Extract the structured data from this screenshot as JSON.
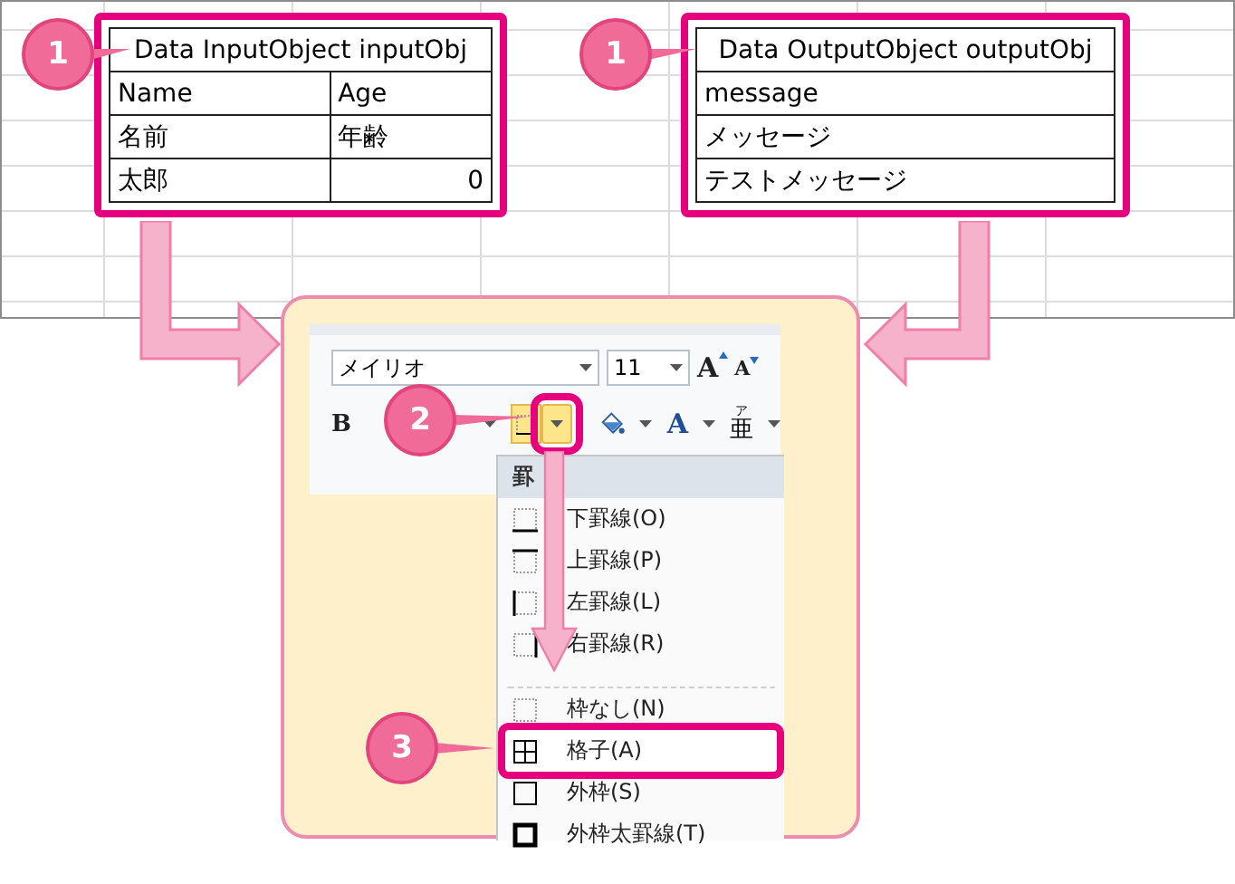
{
  "tables": [
    {
      "title": "Data InputObject inputObj",
      "rows": [
        [
          {
            "text": "Name",
            "kind": "text"
          },
          {
            "text": "Age",
            "kind": "text"
          }
        ],
        [
          {
            "text": "名前",
            "kind": "text"
          },
          {
            "text": "年齢",
            "kind": "text"
          }
        ],
        [
          {
            "text": "太郎",
            "kind": "text"
          },
          {
            "text": "0",
            "kind": "number"
          }
        ]
      ]
    },
    {
      "title": "Data OutputObject outputObj",
      "rows": [
        [
          {
            "text": "message",
            "kind": "text"
          }
        ],
        [
          {
            "text": "メッセージ",
            "kind": "text"
          }
        ],
        [
          {
            "text": "テストメッセージ",
            "kind": "text"
          }
        ]
      ]
    }
  ],
  "callouts": [
    {
      "number": "1"
    },
    {
      "number": "1"
    },
    {
      "number": "2"
    },
    {
      "number": "3"
    }
  ],
  "ribbon": {
    "font": "メイリオ",
    "size": "11",
    "grow": "A",
    "shrink": "A",
    "bold": "B",
    "font_color": "A",
    "phonetic": "亜",
    "phonetic_ruby": "ア",
    "border_dropdown_selected": true
  },
  "menu": {
    "header": "罫",
    "items": [
      {
        "label": "下罫線(O)",
        "kind": "bottom",
        "selected": false,
        "separator_before": false
      },
      {
        "label": "上罫線(P)",
        "kind": "top",
        "selected": false,
        "separator_before": false
      },
      {
        "label": "左罫線(L)",
        "kind": "left",
        "selected": false,
        "separator_before": false
      },
      {
        "label": "右罫線(R)",
        "kind": "right",
        "selected": false,
        "separator_before": false
      },
      {
        "label": "枠なし(N)",
        "kind": "none",
        "selected": false,
        "separator_before": true
      },
      {
        "label": "格子(A)",
        "kind": "all",
        "selected": true,
        "separator_before": false
      },
      {
        "label": "外枠(S)",
        "kind": "outside",
        "selected": false,
        "separator_before": false
      },
      {
        "label": "外枠太罫線(T)",
        "kind": "thick",
        "selected": false,
        "separator_before": false
      }
    ]
  }
}
